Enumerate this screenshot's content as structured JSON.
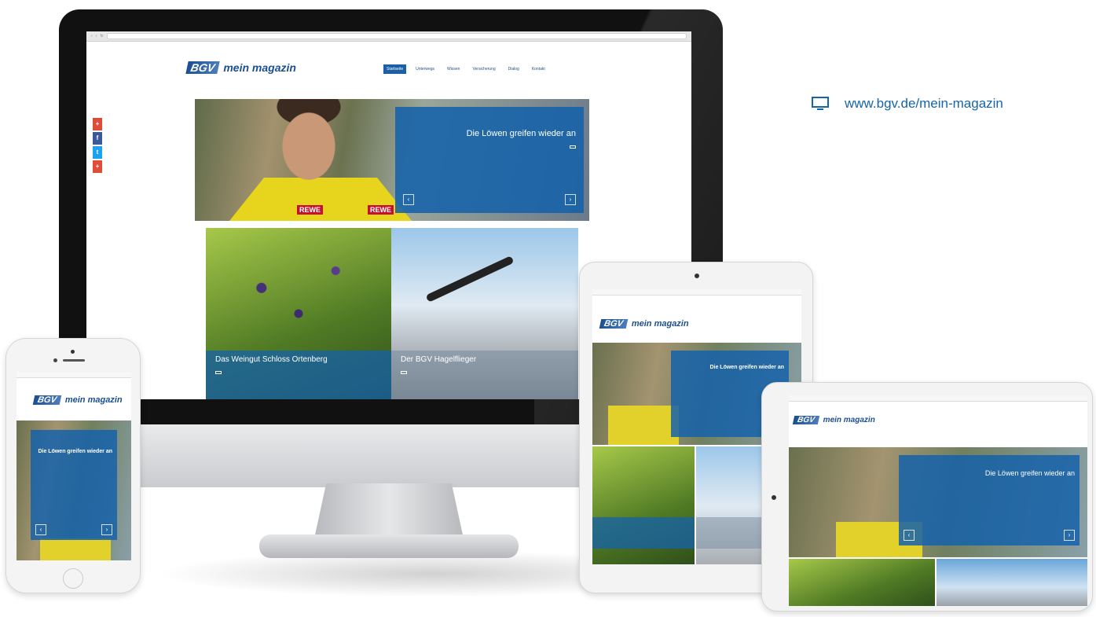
{
  "url_label": "www.bgv.de/mein-magazin",
  "icons": {
    "monitor": "monitor-icon",
    "facebook": "facebook-icon",
    "twitter": "twitter-icon",
    "google_plus": "google-plus-icon",
    "arrow": "arrow-right-icon"
  },
  "colors": {
    "brand_blue": "#1b5fa5",
    "url_blue": "#1565a8",
    "jersey_yellow": "#e7d51d",
    "rewe_red": "#c8102e"
  },
  "brand": {
    "bgv": "BGV",
    "magazine": "mein magazin"
  },
  "desktop": {
    "nav": [
      "Startseite",
      "Unterwegs",
      "Wissen",
      "Versicherung",
      "Dialog",
      "Kontakt"
    ],
    "social": [
      "+",
      "f",
      "t",
      "+"
    ],
    "hero": {
      "title": "Die Löwen greifen wieder an",
      "sponsor": "REWE"
    },
    "tiles": [
      {
        "title": "Das Weingut Schloss Ortenberg"
      },
      {
        "title": "Der BGV Hagelflieger"
      }
    ]
  },
  "phone": {
    "hero_title": "Die Löwen greifen wieder an"
  },
  "tablet_portrait": {
    "hero_title": "Die Löwen greifen wieder an"
  },
  "tablet_landscape": {
    "hero_title": "Die Löwen greifen wieder an"
  }
}
